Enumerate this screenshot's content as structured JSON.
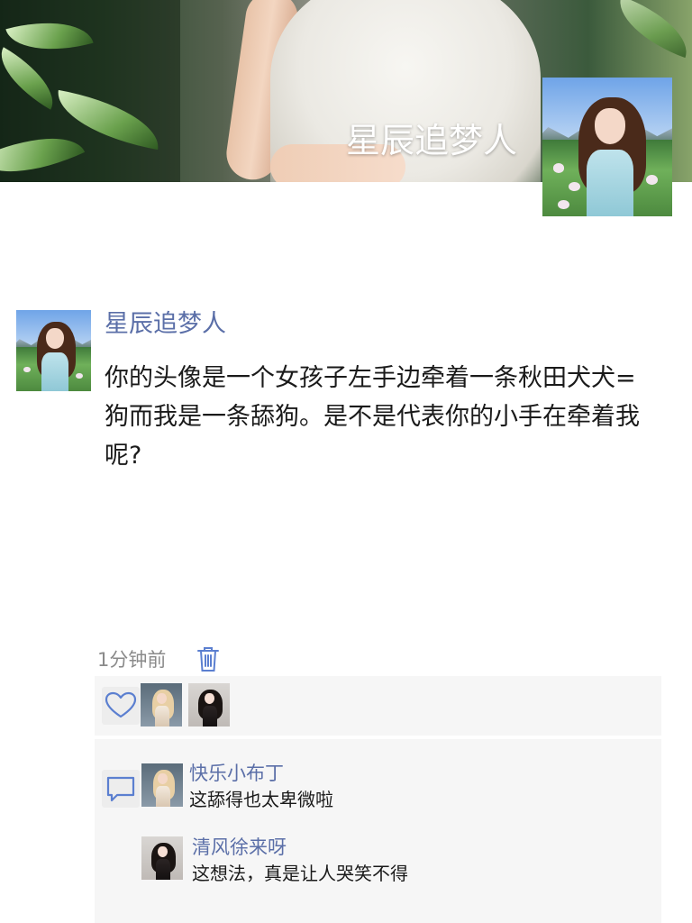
{
  "cover": {
    "username": "星辰追梦人",
    "avatar_icon": "profile-photo-girl-field"
  },
  "post": {
    "author": "星辰追梦人",
    "text": "你的头像是一个女孩子左手边牵着一条秋田犬犬=狗而我是一条舔狗。是不是代表你的小手在牵着我呢?",
    "time": "1分钟前",
    "delete_icon": "trash-icon"
  },
  "likes": {
    "icon": "heart-icon",
    "users": [
      "blonde-girl-avatar",
      "dark-hair-girl-avatar"
    ]
  },
  "comments": {
    "icon": "comment-icon",
    "items": [
      {
        "name": "快乐小布丁",
        "text": "这舔得也太卑微啦",
        "avatar": "blonde-girl-avatar"
      },
      {
        "name": "清风徐来呀",
        "text": "这想法，真是让人哭笑不得",
        "avatar": "dark-hair-girl-avatar"
      }
    ]
  },
  "colors": {
    "name_blue": "#5b6fa8",
    "icon_blue": "#5b7fd0",
    "panel_bg": "#f6f6f6"
  }
}
